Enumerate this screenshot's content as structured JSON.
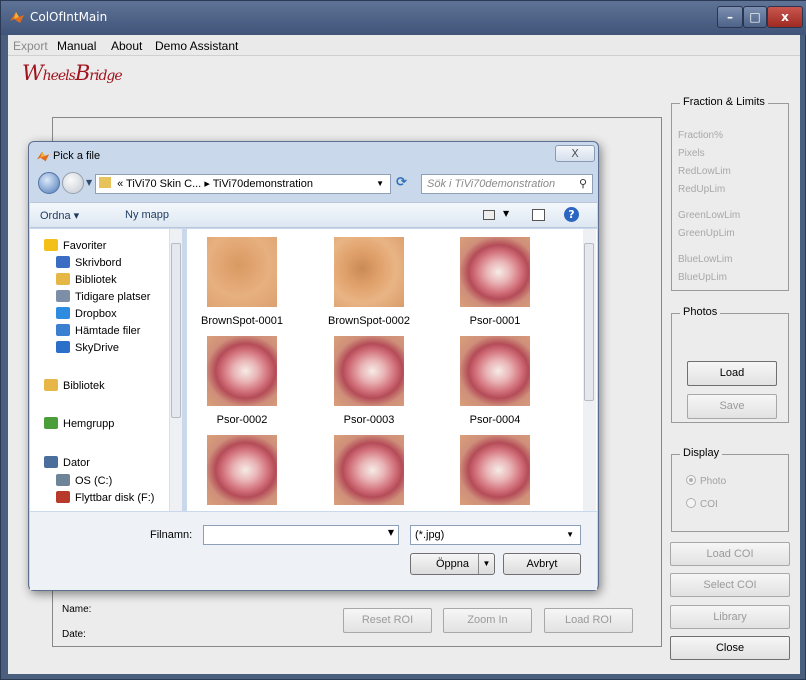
{
  "window": {
    "title": "ColOfIntMain",
    "min_label": "–",
    "max_label": "□",
    "close_label": "x"
  },
  "menu": [
    "Export",
    "Manual",
    "About",
    "Demo Assistant"
  ],
  "logo": {
    "text1": "W",
    "text2": "heels",
    "text3": "B",
    "text4": "ridge"
  },
  "fraction_group": {
    "title": "Fraction & Limits",
    "items": [
      "Fraction%",
      "Pixels",
      "RedLowLim",
      "RedUpLim",
      "GreenLowLim",
      "GreenUpLim",
      "BlueLowLim",
      "BlueUpLim"
    ]
  },
  "photos_group": {
    "title": "Photos",
    "load_label": "Load",
    "save_label": "Save"
  },
  "display_group": {
    "title": "Display",
    "photo_label": "Photo",
    "coi_label": "COI",
    "selected": "Photo"
  },
  "buttons": {
    "load_coi": "Load COI",
    "select_coi": "Select COI",
    "library": "Library",
    "close": "Close",
    "reset_roi": "Reset ROI",
    "zoom_in": "Zoom In",
    "load_roi": "Load ROI"
  },
  "info": {
    "name_label": "Name:",
    "date_label": "Date:"
  },
  "dialog": {
    "title": "Pick a file",
    "close_label": "X",
    "address": {
      "prefix": "«",
      "part1": "TiVi70 Skin C...",
      "sep": "▸",
      "part2": "TiVi70demonstration"
    },
    "search_placeholder": "Sök i TiVi70demonstration",
    "toolbar": {
      "organize": "Ordna ▾",
      "new_folder": "Ny mapp"
    },
    "nav": [
      {
        "label": "Favoriter",
        "icon": "star-icon",
        "level": 0
      },
      {
        "label": "Skrivbord",
        "icon": "desktop-icon",
        "level": 1
      },
      {
        "label": "Bibliotek",
        "icon": "library-icon",
        "level": 1
      },
      {
        "label": "Tidigare platser",
        "icon": "recent-places-icon",
        "level": 1
      },
      {
        "label": "Dropbox",
        "icon": "dropbox-icon",
        "level": 1
      },
      {
        "label": "Hämtade filer",
        "icon": "downloads-icon",
        "level": 1
      },
      {
        "label": "SkyDrive",
        "icon": "skydrive-icon",
        "level": 1
      },
      {
        "label": "Bibliotek",
        "icon": "library-icon",
        "level": 0
      },
      {
        "label": "Hemgrupp",
        "icon": "homegroup-icon",
        "level": 0
      },
      {
        "label": "Dator",
        "icon": "computer-icon",
        "level": 0
      },
      {
        "label": "OS (C:)",
        "icon": "drive-icon",
        "level": 1
      },
      {
        "label": "Flyttbar disk (F:)",
        "icon": "removable-drive-icon",
        "level": 1
      }
    ],
    "files": [
      "BrownSpot-0001",
      "BrownSpot-0002",
      "Psor-0001",
      "Psor-0002",
      "Psor-0003",
      "Psor-0004",
      "",
      "",
      ""
    ],
    "filename_label": "Filnamn:",
    "filename_value": "",
    "filter_value": "(*.jpg)",
    "open_label": "Öppna",
    "cancel_label": "Avbryt"
  }
}
